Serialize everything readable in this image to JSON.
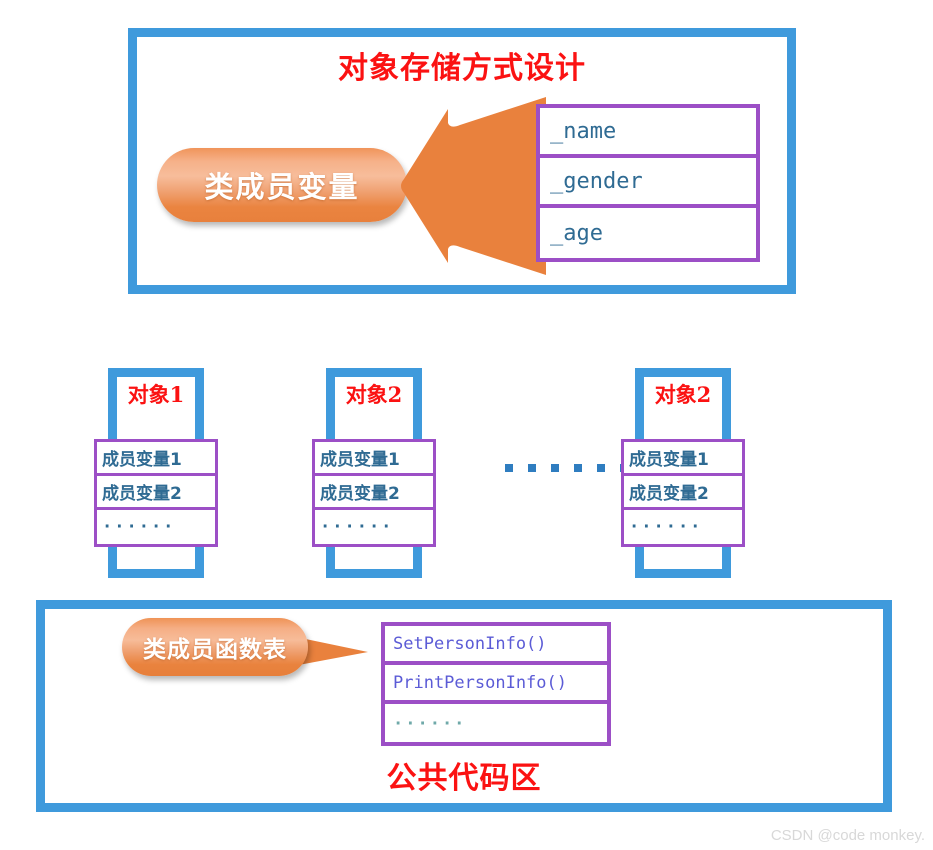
{
  "colors": {
    "blue_frame": "#3f9adc",
    "purple_border": "#9c4fc6",
    "red_title": "#fb1212",
    "orange_shape": "#e8803c",
    "code_text_blue": "#2f6b93",
    "method_text_blue": "#5b5bd6",
    "watermark_gray": "#d8d8d8"
  },
  "top_section": {
    "title": "对象存储方式设计",
    "pill_label": "类成员变量",
    "arrow_icon": "left-arrow-icon",
    "fields_table": {
      "rows": [
        "_name",
        "_gender",
        "_age"
      ]
    }
  },
  "objects_section": {
    "ellipsis_dots": 6,
    "panels": [
      {
        "title": "对象1",
        "rows": [
          "成员变量1",
          "成员变量2",
          "······"
        ]
      },
      {
        "title": "对象2",
        "rows": [
          "成员变量1",
          "成员变量2",
          "······"
        ]
      },
      {
        "title": "对象2",
        "rows": [
          "成员变量1",
          "成员变量2",
          "······"
        ]
      }
    ]
  },
  "bottom_section": {
    "title": "公共代码区",
    "callout_label": "类成员函数表",
    "methods_table": {
      "rows": [
        "SetPersonInfo()",
        "PrintPersonInfo()",
        "······"
      ]
    }
  },
  "watermark": {
    "text": "CSDN @code monkey."
  }
}
